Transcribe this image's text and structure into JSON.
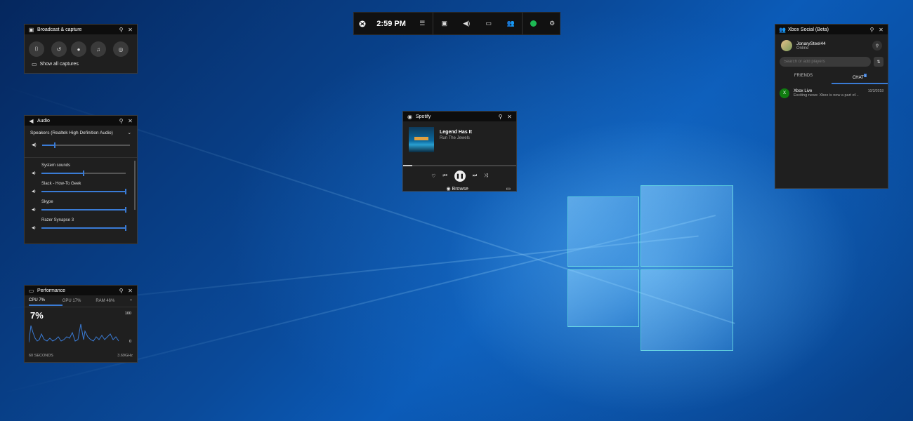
{
  "gamebar": {
    "clock": "2:59 PM",
    "icons": [
      "xbox-logo-icon",
      "menu-icon",
      "capture-icon",
      "audio-icon",
      "performance-icon",
      "social-icon",
      "online-status-icon",
      "settings-icon"
    ]
  },
  "broadcast": {
    "title": "Broadcast & capture",
    "show_all": "Show all captures"
  },
  "audio": {
    "title": "Audio",
    "device": "Speakers (Realtek High Definition Audio)",
    "master_level": 0.15,
    "apps": [
      {
        "name": "System sounds",
        "level": 0.5
      },
      {
        "name": "Slack - How-To Geek",
        "level": 1.0
      },
      {
        "name": "Skype",
        "level": 1.0
      },
      {
        "name": "Razer Synapse 3",
        "level": 1.0
      }
    ]
  },
  "performance": {
    "title": "Performance",
    "tabs": [
      "CPU 7%",
      "GPU 17%",
      "RAM 46%"
    ],
    "big_value": "7%",
    "ymax_label": "100",
    "ymin_label": "0",
    "x_left": "60 SECONDS",
    "x_right": "3.69GHz"
  },
  "spotify": {
    "title": "Spotify",
    "track": "Legend Has It",
    "artist": "Run The Jewels",
    "progress": 0.08,
    "browse": "Browse"
  },
  "social": {
    "title": "Xbox Social (Beta)",
    "user": "JonarySteel44",
    "status": "Online",
    "search_placeholder": "Search or add players",
    "tabs": [
      "FRIENDS",
      "CHAT"
    ],
    "chat_badge": "1",
    "chat_name": "Xbox Live",
    "chat_time": "10/3/2018",
    "chat_preview": "Exciting news: Xbox is now a part of..."
  }
}
